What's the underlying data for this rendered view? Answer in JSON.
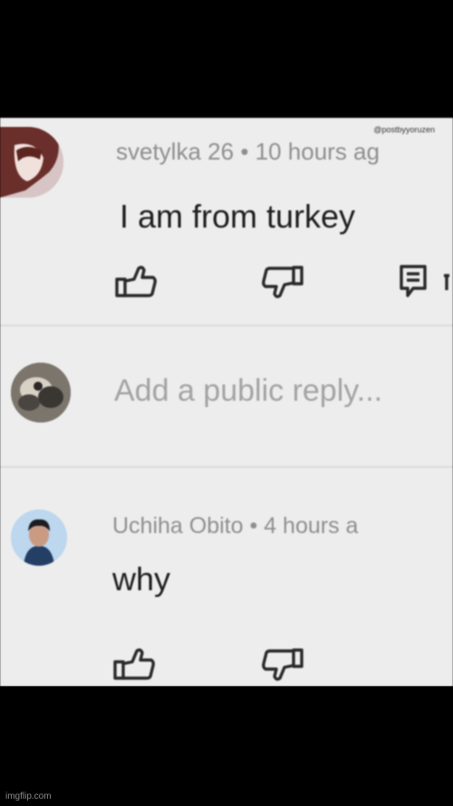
{
  "watermark": "@postbyyoruzen",
  "comments": [
    {
      "author": "svetylka 26",
      "separator": "•",
      "time": "10 hours ag",
      "text": "I am from turkey"
    },
    {
      "author": "Uchiha Obito",
      "separator": "•",
      "time": "4 hours a",
      "text": "why"
    }
  ],
  "reply": {
    "placeholder": "Add a public reply..."
  },
  "icons": {
    "like": "thumbs-up-icon",
    "dislike": "thumbs-down-icon",
    "reply": "reply-icon"
  },
  "footer": {
    "credit": "imgflip.com"
  },
  "colors": {
    "background": "#ededed",
    "frame": "#000000",
    "meta_text": "#8f8f8f",
    "body_text": "#1f1f1f"
  }
}
